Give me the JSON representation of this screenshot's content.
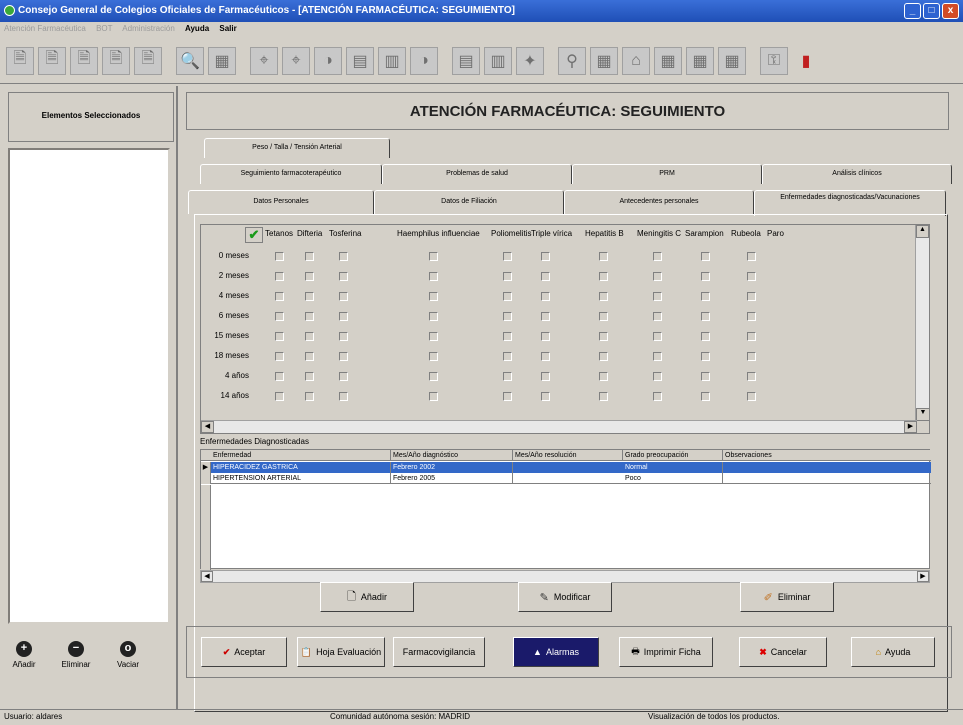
{
  "window": {
    "title": "Consejo General de Colegios Oficiales de Farmacéuticos - [ATENCIÓN FARMACÉUTICA: SEGUIMIENTO]",
    "buttons": [
      "_",
      "□",
      "x"
    ]
  },
  "menubar": {
    "items": [
      {
        "label": "Atención Farmacéutica",
        "enabled": false
      },
      {
        "label": "BOT",
        "enabled": false
      },
      {
        "label": "Administración",
        "enabled": false
      },
      {
        "label": "Ayuda",
        "enabled": true
      },
      {
        "label": "Salir",
        "enabled": true
      }
    ]
  },
  "toolbar": {
    "icons": [
      "doc-icon",
      "doc-icon",
      "doc-icon",
      "doc-icon",
      "doc-icon",
      "search-icon",
      "grid-icon",
      "binoculars-icon",
      "binoculars-icon",
      "pill-icon",
      "chart-icon",
      "table-icon",
      "pill-icon",
      "chart-icon",
      "table-icon",
      "tool-icon",
      "pin-icon",
      "grid-icon",
      "house-icon",
      "grid-icon",
      "grid-icon",
      "grid-icon",
      "key-icon",
      "exit-icon"
    ]
  },
  "left_panel": {
    "header": "Elementos Seleccionados",
    "buttons": [
      {
        "label": "Añadir",
        "icon": "+"
      },
      {
        "label": "Eliminar",
        "icon": "−"
      },
      {
        "label": "Vaciar",
        "icon": "o"
      }
    ]
  },
  "main": {
    "title": "ATENCIÓN FARMACÉUTICA: SEGUIMIENTO"
  },
  "tabs": {
    "row1": [
      "Peso / Talla / Tensión Arterial"
    ],
    "row2": [
      "Seguimiento farmacoterapéutico",
      "Problemas de salud",
      "PRM",
      "Análisis clínicos"
    ],
    "row3": [
      "Datos Personales",
      "Datos de Filiación",
      "Antecedentes personales",
      "Enfermedades diagnosticadas/Vacunaciones"
    ]
  },
  "vaccines": {
    "columns": [
      "Tetanos",
      "Difteria",
      "Tosferina",
      "Haemphilus influenciae",
      "Poliomelitis",
      "Triple vírica",
      "Hepatitis B",
      "Meningitis C",
      "Sarampion",
      "Rubeola",
      "Paro"
    ],
    "rows": [
      "0 meses",
      "2 meses",
      "4 meses",
      "6 meses",
      "15 meses",
      "18 meses",
      "4 años",
      "14 años"
    ]
  },
  "diagnosed": {
    "label": "Enfermedades Diagnosticadas",
    "columns": [
      "Enfermedad",
      "Mes/Año diagnóstico",
      "Mes/Año resolución",
      "Grado preocupación",
      "Observaciones"
    ],
    "rows": [
      {
        "enfermedad": "HIPERACIDEZ GASTRICA",
        "diag": "Febrero 2002",
        "res": "",
        "grado": "Normal",
        "obs": "",
        "selected": true
      },
      {
        "enfermedad": "HIPERTENSION ARTERIAL",
        "diag": "Febrero 2005",
        "res": "",
        "grado": "Poco",
        "obs": "",
        "selected": false
      }
    ]
  },
  "actions": {
    "add": "Añadir",
    "modify": "Modificar",
    "delete": "Eliminar"
  },
  "bottom_buttons": [
    {
      "label": "Aceptar",
      "icon": "✔"
    },
    {
      "label": "Hoja Evaluación",
      "icon": "📋"
    },
    {
      "label": "Farmacovigilancia",
      "icon": ""
    },
    {
      "label": "Alarmas",
      "icon": "▲"
    },
    {
      "label": "Imprimir Ficha",
      "icon": "🖶"
    },
    {
      "label": "Cancelar",
      "icon": "✖"
    },
    {
      "label": "Ayuda",
      "icon": "⌂"
    }
  ],
  "status": {
    "user": "Usuario: aldares",
    "community": "Comunidad autónoma sesión: MADRID",
    "message": "Visualización de todos los productos."
  }
}
